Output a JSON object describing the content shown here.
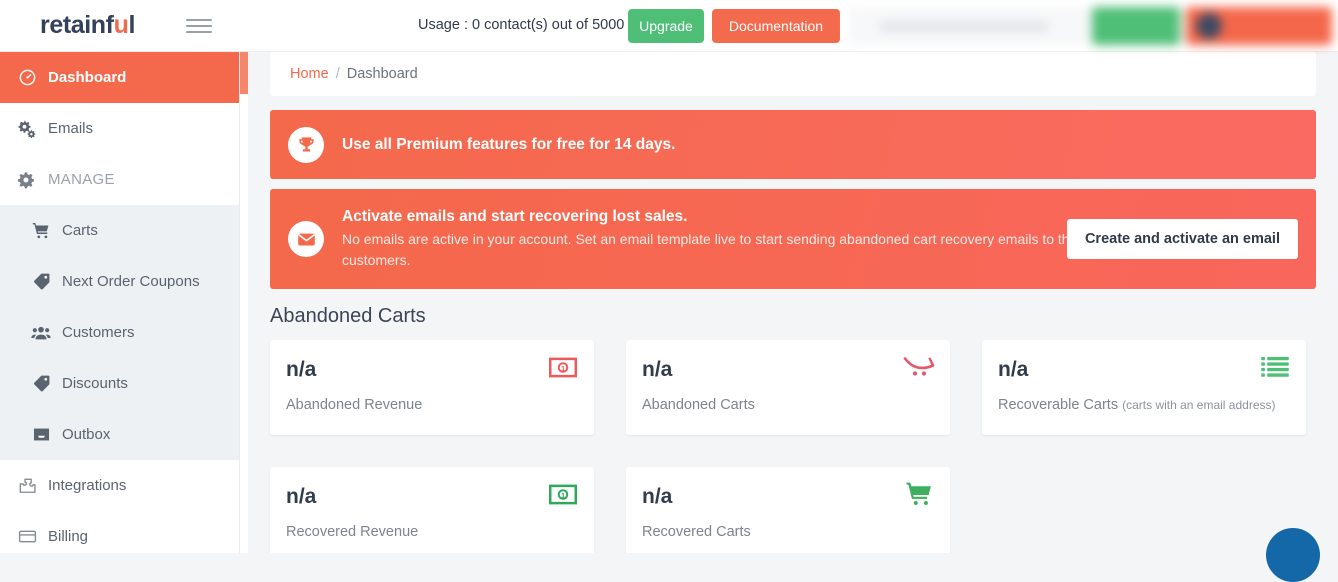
{
  "header": {
    "brand_prefix": "retainf",
    "brand_accent": "u",
    "brand_suffix": "l",
    "menu_icon": "hamburger-icon",
    "usage_text": "Usage : 0 contact(s) out of 5000",
    "upgrade_label": "Upgrade",
    "documentation_label": "Documentation",
    "upgrade_color": "#4fbf77",
    "documentation_color": "#f36a4c"
  },
  "sidebar": {
    "items": [
      {
        "label": "Dashboard",
        "icon": "gauge-icon",
        "active": true,
        "sub": false
      },
      {
        "label": "Emails",
        "icon": "gears-icon",
        "active": false,
        "sub": false
      },
      {
        "label": "MANAGE",
        "icon": "gear-icon",
        "active": false,
        "sub": false,
        "muted": true
      },
      {
        "label": "Carts",
        "icon": "cart-icon",
        "active": false,
        "sub": true
      },
      {
        "label": "Next Order Coupons",
        "icon": "tag-icon",
        "active": false,
        "sub": true
      },
      {
        "label": "Customers",
        "icon": "users-icon",
        "active": false,
        "sub": true
      },
      {
        "label": "Discounts",
        "icon": "tag-icon",
        "active": false,
        "sub": true
      },
      {
        "label": "Outbox",
        "icon": "inbox-icon",
        "active": false,
        "sub": true
      },
      {
        "label": "Integrations",
        "icon": "puzzle-icon",
        "active": false,
        "sub": false
      },
      {
        "label": "Billing",
        "icon": "credit-card-icon",
        "active": false,
        "sub": false
      }
    ],
    "active_color": "#f4694b"
  },
  "breadcrumb": {
    "home": "Home",
    "separator": "/",
    "current": "Dashboard"
  },
  "premium_banner": {
    "icon": "trophy-icon",
    "text": "Use all Premium features for free for 14 days.",
    "background": "#f4694b"
  },
  "activate_banner": {
    "icon": "envelope-icon",
    "title": "Activate emails and start recovering lost sales.",
    "description": "No emails are active in your account. Set an email template live to start sending abandoned cart recovery emails to the customers.",
    "button_label": "Create and activate an email",
    "background": "#f4694b"
  },
  "main": {
    "section_title": "Abandoned Carts",
    "cards": [
      {
        "value": "n/a",
        "label": "Abandoned Revenue",
        "note": "",
        "icon": "banknote-icon",
        "color": "#ee5a5a"
      },
      {
        "value": "n/a",
        "label": "Abandoned Carts",
        "note": "",
        "icon": "cart-outline-icon",
        "color": "#e8566b"
      },
      {
        "value": "n/a",
        "label": "Recoverable Carts",
        "note": "(carts with an email address)",
        "icon": "list-icon",
        "color": "#4fbf77"
      },
      {
        "value": "n/a",
        "label": "Recovered Revenue",
        "note": "",
        "icon": "banknote-icon",
        "color": "#2fa959"
      },
      {
        "value": "n/a",
        "label": "Recovered Carts",
        "note": "",
        "icon": "cart-solid-icon",
        "color": "#3cb05e"
      }
    ]
  },
  "chat_widget": {
    "icon": "chat-icon",
    "color": "#1468a8"
  }
}
